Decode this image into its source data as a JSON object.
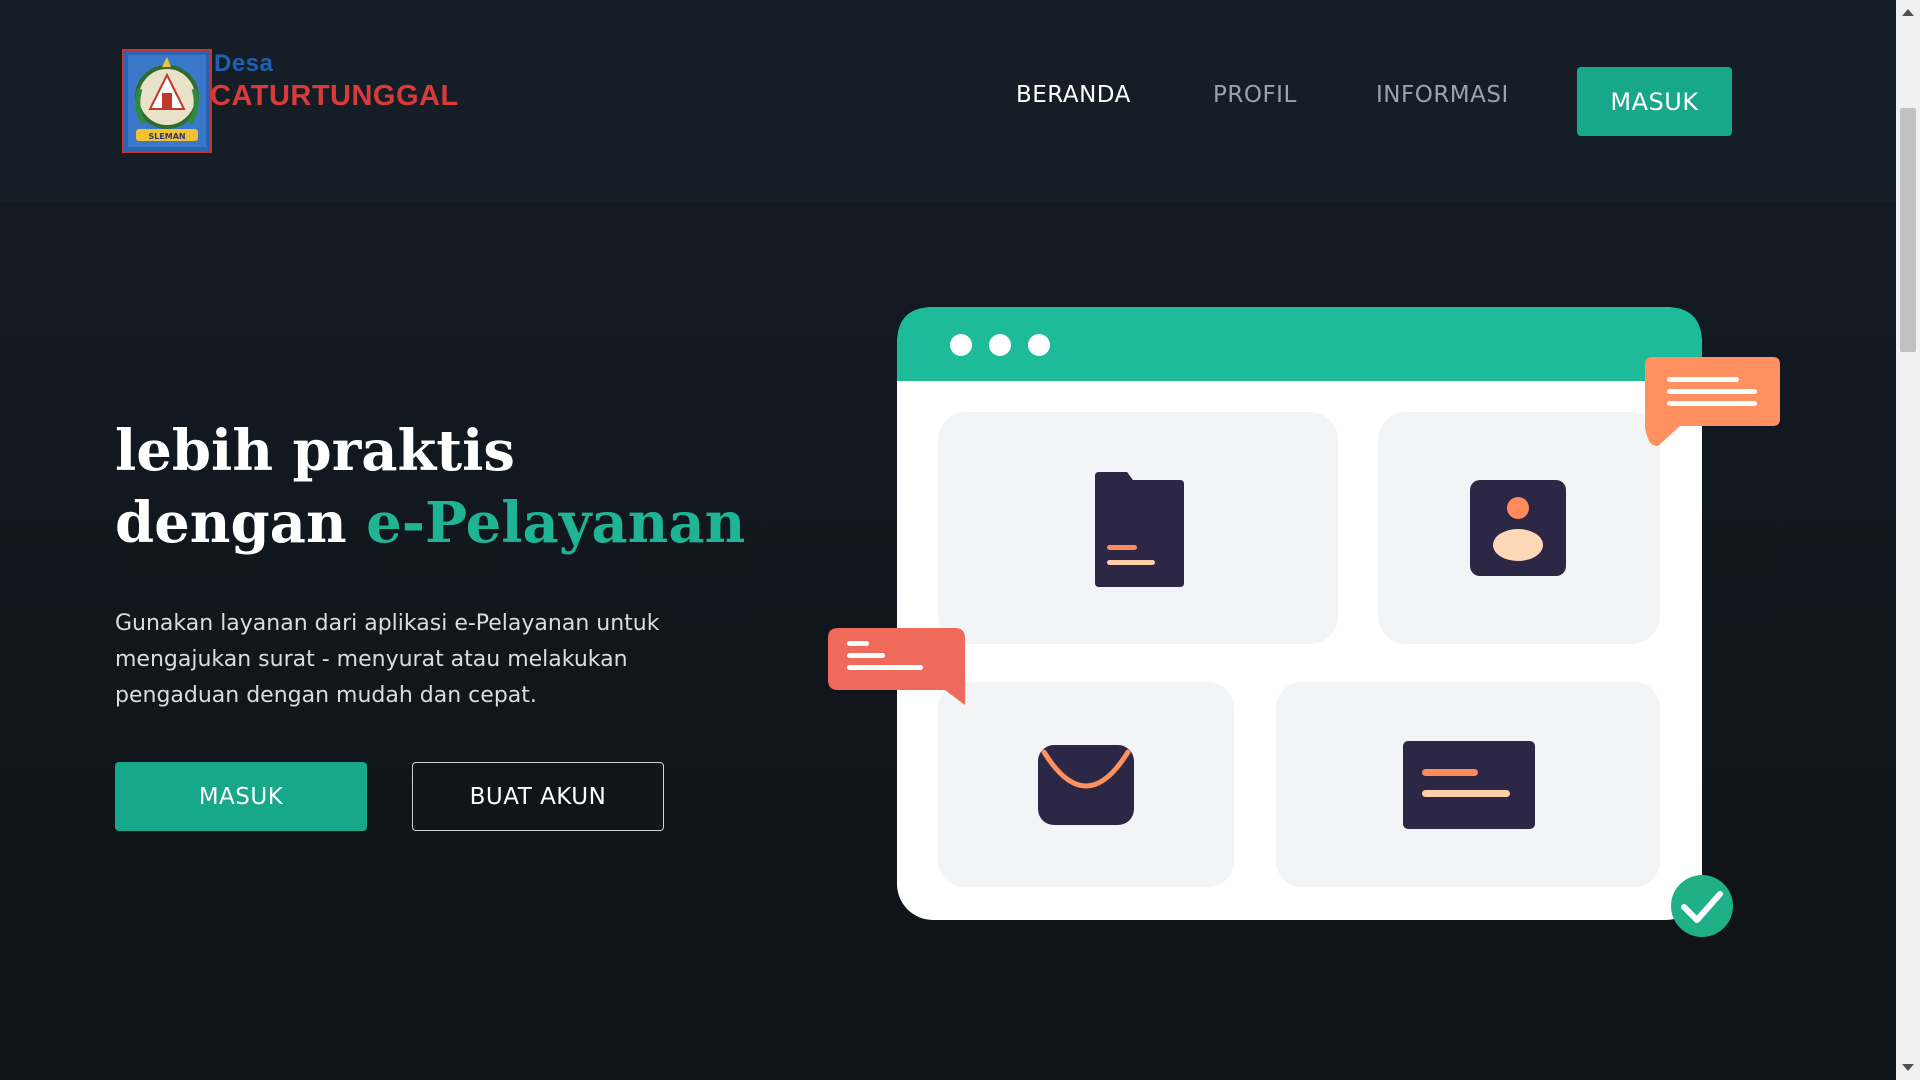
{
  "brand": {
    "small": "Desa",
    "big": "CATURTUNGGAL",
    "logo_icon": "sleman-crest-icon"
  },
  "nav": {
    "items": [
      {
        "label": "BERANDA",
        "active": true
      },
      {
        "label": "PROFIL",
        "active": false
      },
      {
        "label": "INFORMASI",
        "active": false
      }
    ],
    "login_label": "MASUK"
  },
  "hero": {
    "title_line1": "lebih praktis",
    "title_line2_prefix": "dengan ",
    "title_line2_accent": "e-Pelayanan",
    "description": "Gunakan layanan dari aplikasi e-Pelayanan untuk mengajukan surat - menyurat atau melakukan pengaduan dengan mudah dan cepat.",
    "primary_button": "MASUK",
    "secondary_button": "BUAT AKUN"
  },
  "illustration": {
    "icons": [
      "document-icon",
      "user-profile-icon",
      "mail-icon",
      "message-card-icon",
      "chat-bubble-icon",
      "check-circle-icon"
    ]
  },
  "colors": {
    "accent": "#1fb493",
    "button": "#16a888",
    "orange": "#ff9060",
    "red": "#ef6a5a",
    "dark_icon": "#2b2744",
    "background": "#111619"
  }
}
